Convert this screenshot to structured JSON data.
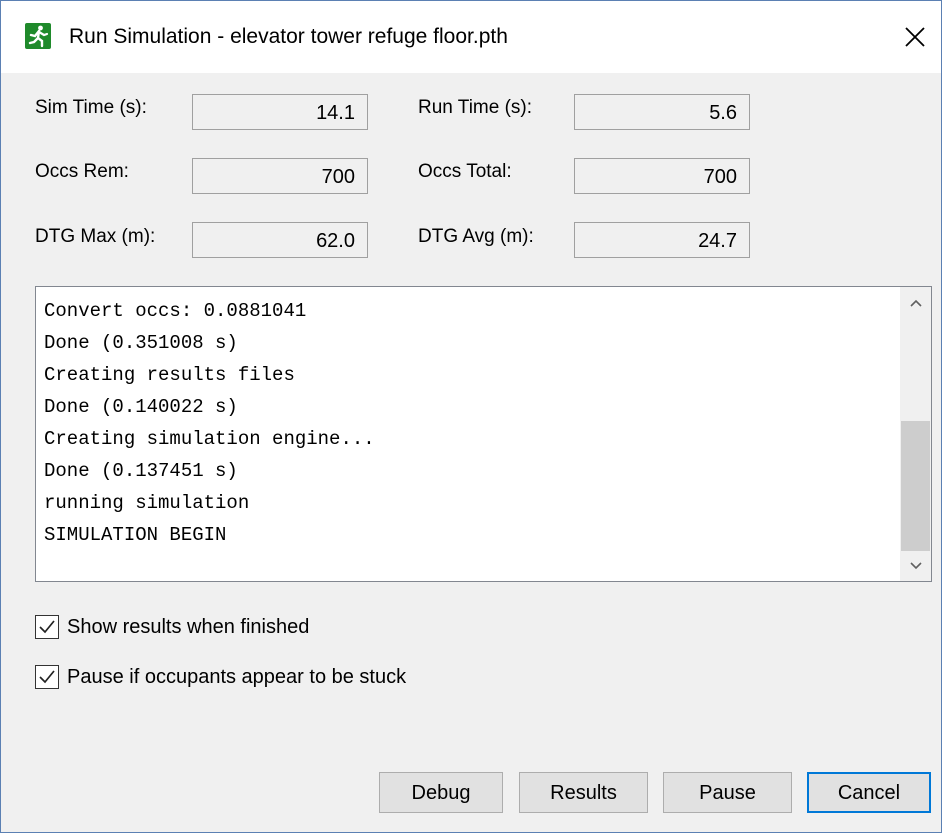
{
  "window": {
    "title": "Run Simulation - elevator tower refuge floor.pth",
    "app_icon": "running-man-exit-icon",
    "close_icon": "close-icon"
  },
  "stats": {
    "sim_time": {
      "label": "Sim Time (s):",
      "value": "14.1"
    },
    "run_time": {
      "label": "Run Time (s):",
      "value": "5.6"
    },
    "occs_rem": {
      "label": "Occs Rem:",
      "value": "700"
    },
    "occs_total": {
      "label": "Occs Total:",
      "value": "700"
    },
    "dtg_max": {
      "label": "DTG Max (m):",
      "value": "62.0"
    },
    "dtg_avg": {
      "label": "DTG Avg (m):",
      "value": "24.7"
    }
  },
  "log": {
    "lines": [
      "Convert occs: 0.0881041",
      "Done (0.351008 s)",
      "Creating results files",
      "Done (0.140022 s)",
      "Creating simulation engine...",
      "Done (0.137451 s)",
      "running simulation",
      "SIMULATION BEGIN"
    ]
  },
  "options": {
    "show_results": {
      "label": "Show results when finished",
      "checked": true
    },
    "pause_stuck": {
      "label": "Pause if occupants appear to be stuck",
      "checked": true
    }
  },
  "buttons": {
    "debug": "Debug",
    "results": "Results",
    "pause": "Pause",
    "cancel": "Cancel"
  },
  "colors": {
    "window_border": "#5b80b3",
    "dialog_bg": "#f0f0f0",
    "icon_green": "#1f8a2b",
    "default_button_border": "#0078d7"
  }
}
